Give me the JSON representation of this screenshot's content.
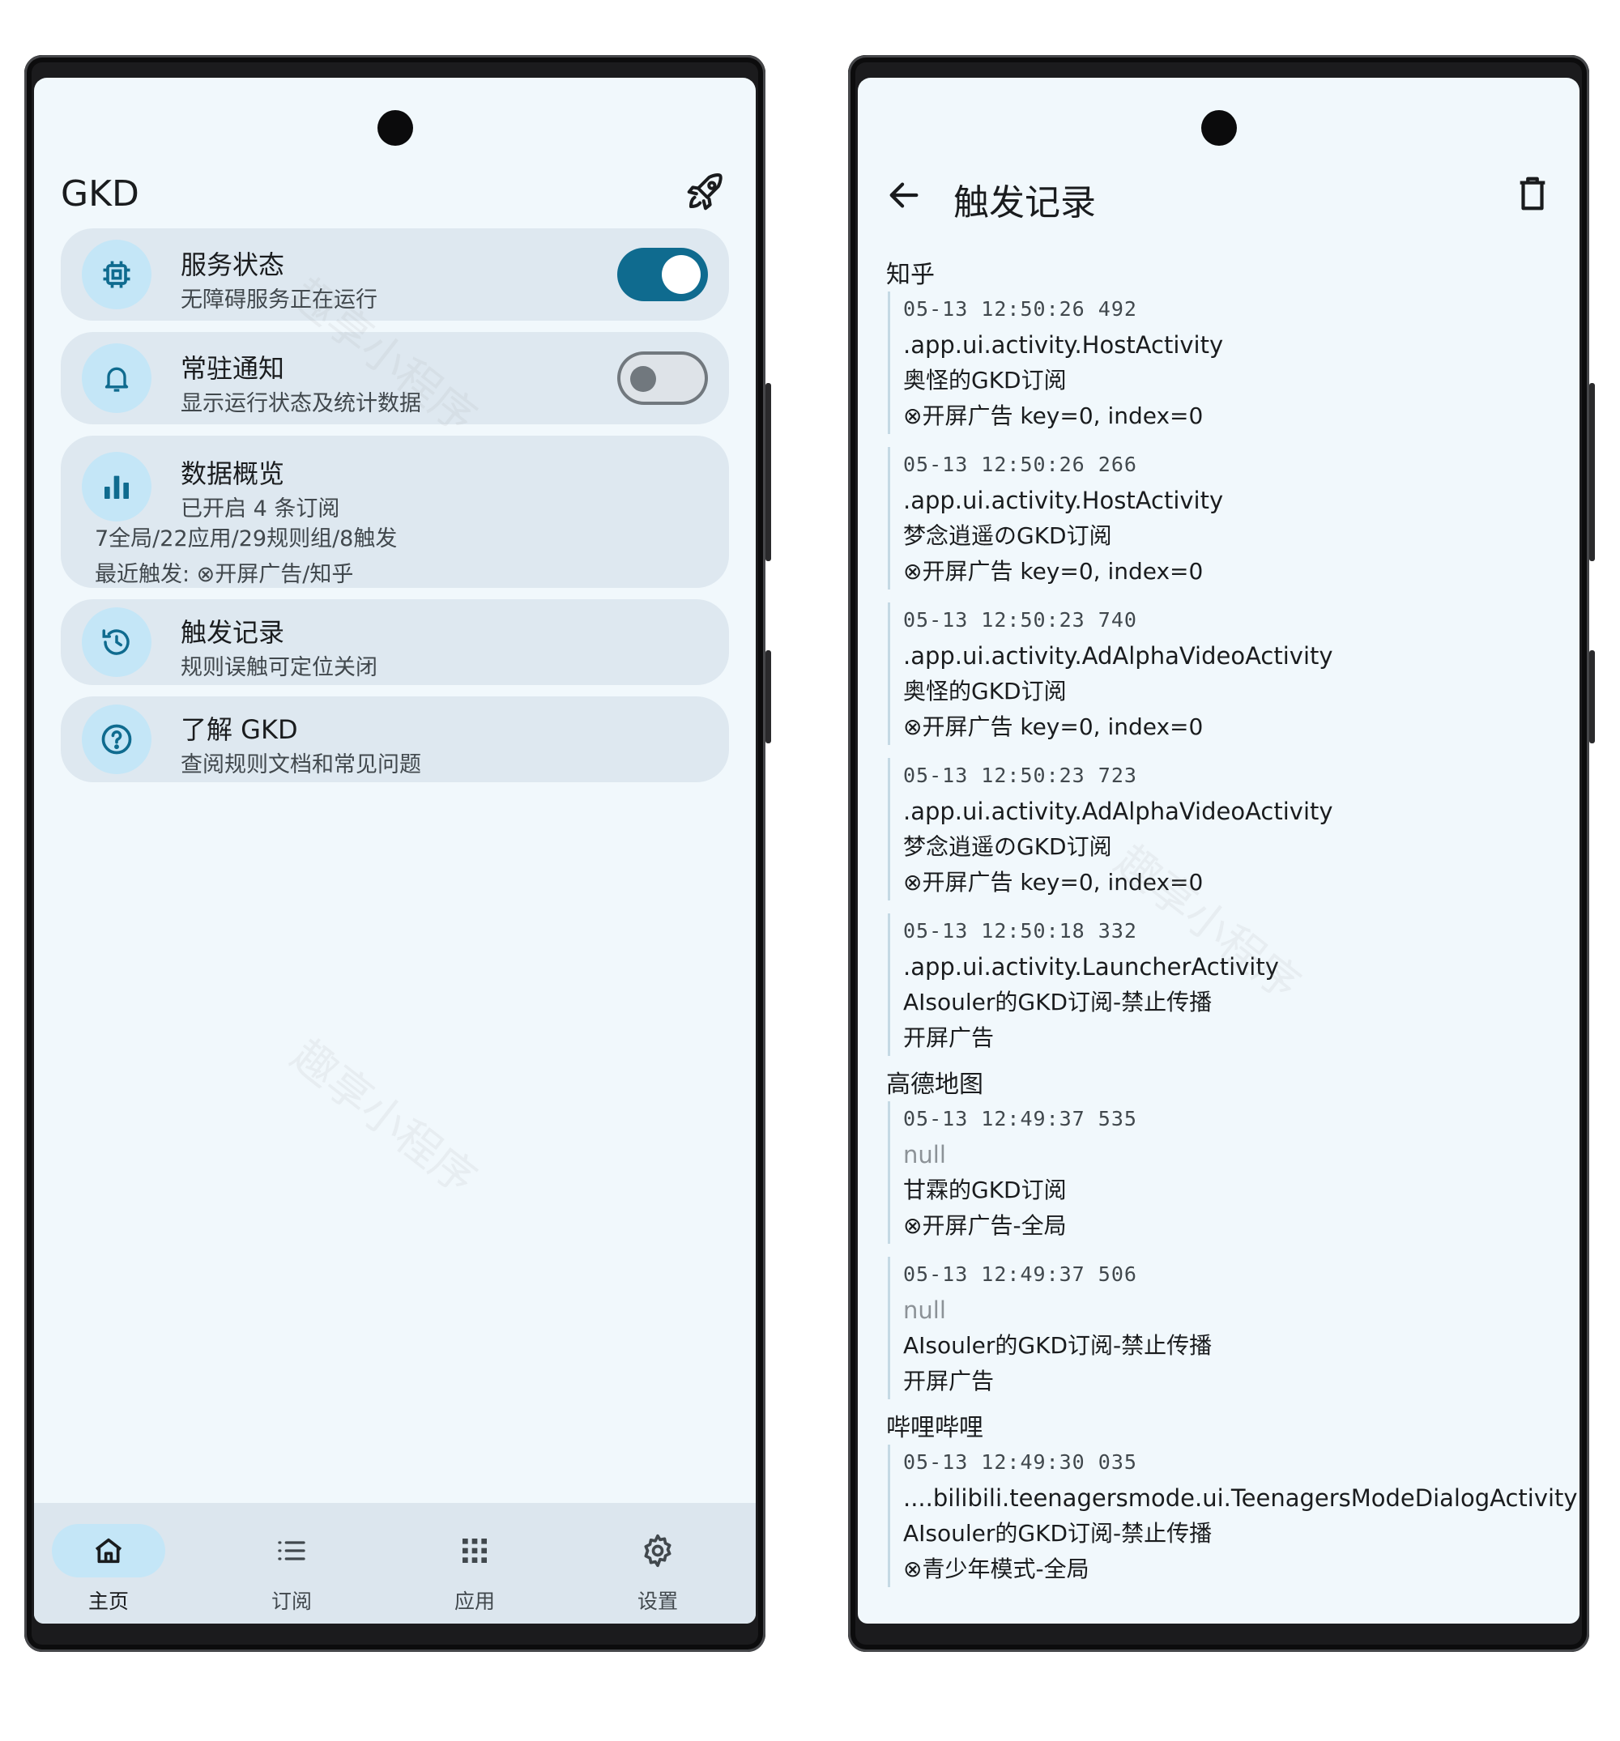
{
  "left": {
    "app_title": "GKD",
    "cards": {
      "service": {
        "title": "服务状态",
        "subtitle": "无障碍服务正在运行"
      },
      "notify": {
        "title": "常驻通知",
        "subtitle": "显示运行状态及统计数据"
      },
      "data": {
        "title": "数据概览",
        "subtitle": "已开启 4 条订阅",
        "line1": "7全局/22应用/29规则组/8触发",
        "line2": "最近触发: ⊗开屏广告/知乎"
      },
      "records": {
        "title": "触发记录",
        "subtitle": "规则误触可定位关闭"
      },
      "about": {
        "title": "了解 GKD",
        "subtitle": "查阅规则文档和常见问题"
      }
    },
    "switches": {
      "service_on": true,
      "notify_on": false
    },
    "nav": {
      "home": "主页",
      "subscriptions": "订阅",
      "apps": "应用",
      "settings": "设置"
    },
    "watermark": "趣享小程序"
  },
  "right": {
    "title": "触发记录",
    "groups": [
      {
        "app": "知乎",
        "entries": [
          {
            "time": "05-13 12:50:26 492",
            "activity": ".app.ui.activity.HostActivity",
            "subscription": "奥怪的GKD订阅",
            "rule": "⊗开屏广告  key=0, index=0"
          },
          {
            "time": "05-13 12:50:26 266",
            "activity": ".app.ui.activity.HostActivity",
            "subscription": "梦念逍遥のGKD订阅",
            "rule": "⊗开屏广告  key=0, index=0"
          },
          {
            "time": "05-13 12:50:23 740",
            "activity": ".app.ui.activity.AdAlphaVideoActivity",
            "subscription": "奥怪的GKD订阅",
            "rule": "⊗开屏广告  key=0, index=0"
          },
          {
            "time": "05-13 12:50:23 723",
            "activity": ".app.ui.activity.AdAlphaVideoActivity",
            "subscription": "梦念逍遥のGKD订阅",
            "rule": "⊗开屏广告  key=0, index=0"
          },
          {
            "time": "05-13 12:50:18 332",
            "activity": ".app.ui.activity.LauncherActivity",
            "subscription": "AIsouler的GKD订阅-禁止传播",
            "rule": "开屏广告"
          }
        ]
      },
      {
        "app": "高德地图",
        "entries": [
          {
            "time": "05-13 12:49:37 535",
            "activity": "null",
            "subscription": "甘霖的GKD订阅",
            "rule": "⊗开屏广告-全局"
          },
          {
            "time": "05-13 12:49:37 506",
            "activity": "null",
            "subscription": "AIsouler的GKD订阅-禁止传播",
            "rule": "开屏广告"
          }
        ]
      },
      {
        "app": "哔哩哔哩",
        "entries": [
          {
            "time": "05-13 12:49:30 035",
            "activity": "....bilibili.teenagersmode.ui.TeenagersModeDialogActivity",
            "subscription": "AIsouler的GKD订阅-禁止传播",
            "rule": "⊗青少年模式-全局"
          }
        ]
      }
    ],
    "watermark": "趣享小程序"
  },
  "colors": {
    "accent": "#0f6b8f",
    "card": "#dee8f0",
    "icon_bg": "#c4e6f7",
    "screen_bg": "#f1f8fc"
  }
}
